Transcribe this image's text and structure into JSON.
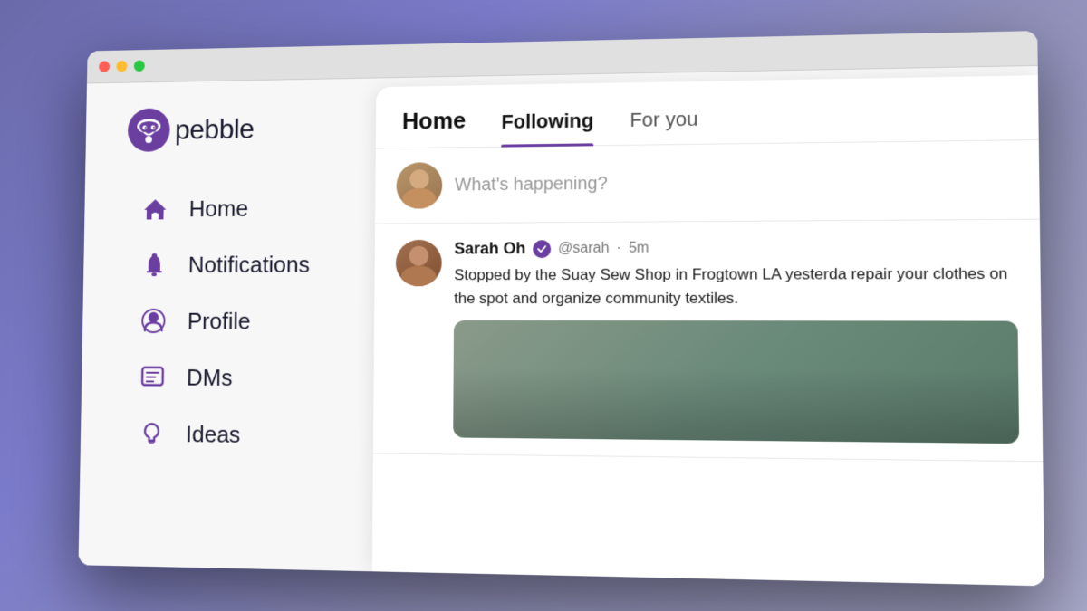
{
  "app": {
    "title": "Pebble"
  },
  "logo": {
    "text": "pebble"
  },
  "nav": {
    "items": [
      {
        "id": "home",
        "label": "Home",
        "icon": "home"
      },
      {
        "id": "notifications",
        "label": "Notifications",
        "icon": "bell"
      },
      {
        "id": "profile",
        "label": "Profile",
        "icon": "person"
      },
      {
        "id": "dms",
        "label": "DMs",
        "icon": "message"
      },
      {
        "id": "ideas",
        "label": "Ideas",
        "icon": "lightbulb"
      }
    ]
  },
  "tabs": {
    "home": "Home",
    "following": "Following",
    "for_you": "For you"
  },
  "compose": {
    "placeholder": "What's happening?"
  },
  "post": {
    "author_name": "Sarah Oh",
    "author_handle": "@sarah",
    "time": "5m",
    "text": "Stopped by the Suay Sew Shop in Frogtown LA yesterda repair your clothes on the spot and organize community textiles.",
    "verified": true
  }
}
